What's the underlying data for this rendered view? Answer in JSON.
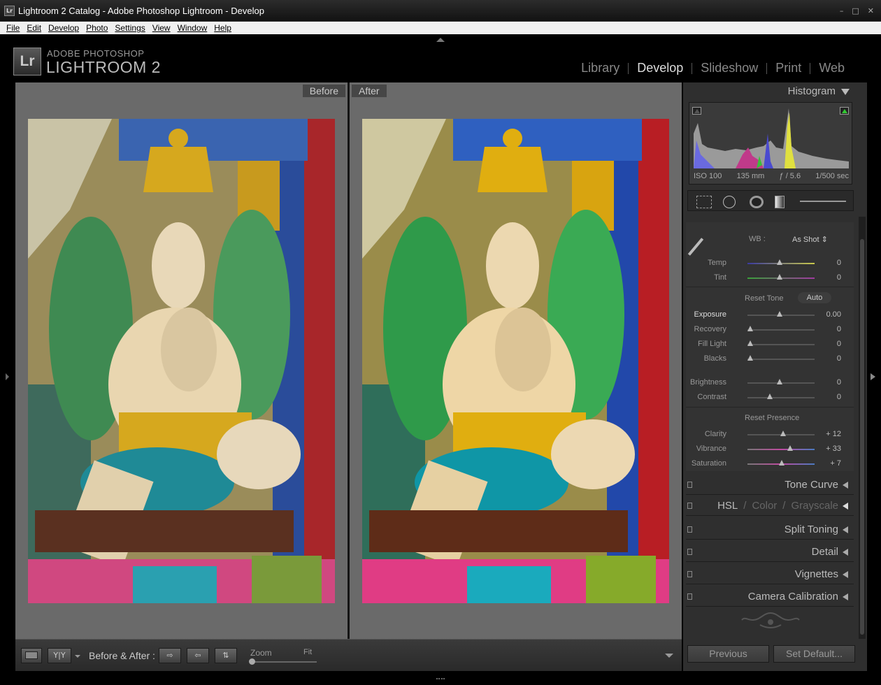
{
  "window": {
    "title": "Lightroom 2 Catalog - Adobe Photoshop Lightroom - Develop",
    "controls": [
      "–",
      "□",
      "✕"
    ]
  },
  "menu": [
    "File",
    "Edit",
    "Develop",
    "Photo",
    "Settings",
    "View",
    "Window",
    "Help"
  ],
  "identity": {
    "badge": "Lr",
    "line1": "ADOBE PHOTOSHOP",
    "line2": "LIGHTROOM 2"
  },
  "modules": [
    {
      "label": "Library",
      "active": false
    },
    {
      "label": "Develop",
      "active": true
    },
    {
      "label": "Slideshow",
      "active": false
    },
    {
      "label": "Print",
      "active": false
    },
    {
      "label": "Web",
      "active": false
    }
  ],
  "view": {
    "before_label": "Before",
    "after_label": "After"
  },
  "toolbar": {
    "before_after_label": "Before & After :",
    "zoom_label": "Zoom",
    "fit_label": "Fit",
    "yy_label": "Y|Y"
  },
  "histogram": {
    "header": "Histogram",
    "iso": "ISO 100",
    "focal": "135 mm",
    "aperture": "ƒ / 5.6",
    "shutter": "1/500 sec"
  },
  "basic": {
    "wb_label": "WB :",
    "wb_value": "As Shot ⇕",
    "reset_tone": "Reset Tone",
    "auto": "Auto",
    "reset_presence": "Reset Presence",
    "sliders": [
      {
        "label": "Temp",
        "value": "0",
        "pos": 0.5
      },
      {
        "label": "Tint",
        "value": "0",
        "pos": 0.5
      },
      {
        "label": "Exposure",
        "value": "0.00",
        "pos": 0.5
      },
      {
        "label": "Recovery",
        "value": "0",
        "pos": 0.0
      },
      {
        "label": "Fill Light",
        "value": "0",
        "pos": 0.0
      },
      {
        "label": "Blacks",
        "value": "0",
        "pos": 0.0
      },
      {
        "label": "Brightness",
        "value": "0",
        "pos": 0.5
      },
      {
        "label": "Contrast",
        "value": "0",
        "pos": 0.3
      },
      {
        "label": "Clarity",
        "value": "+ 12",
        "pos": 0.56
      },
      {
        "label": "Vibrance",
        "value": "+ 33",
        "pos": 0.66
      },
      {
        "label": "Saturation",
        "value": "+ 7",
        "pos": 0.53
      }
    ]
  },
  "panels": [
    "Tone Curve",
    "Split Toning",
    "Detail",
    "Vignettes",
    "Camera Calibration"
  ],
  "hsl": {
    "hsl": "HSL",
    "sep": "/",
    "color": "Color",
    "grayscale": "Grayscale"
  },
  "buttons": {
    "previous": "Previous",
    "set_default": "Set Default..."
  }
}
